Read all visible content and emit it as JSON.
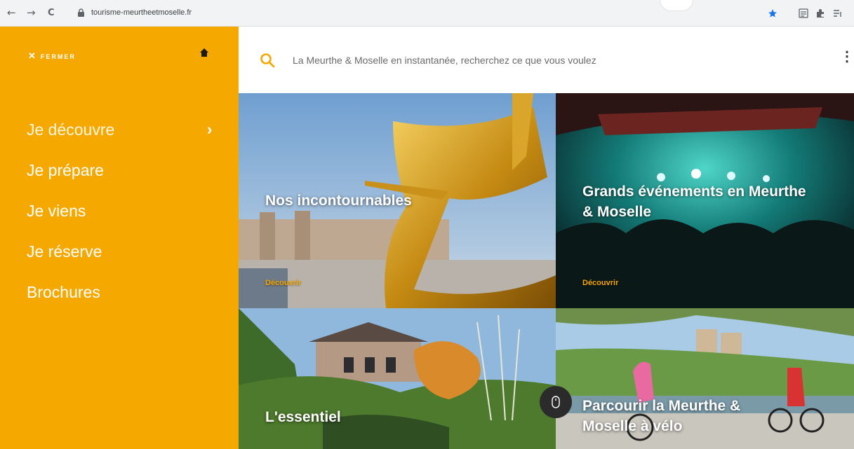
{
  "browser": {
    "url": "tourisme-meurtheetmoselle.fr",
    "back_glyph": "←",
    "forward_glyph": "→",
    "reload_glyph": "C"
  },
  "sidebar": {
    "close_label": "FERMER",
    "close_glyph": "✕",
    "menu": [
      {
        "label": "Je découvre"
      },
      {
        "label": "Je prépare"
      },
      {
        "label": "Je viens"
      },
      {
        "label": "Je réserve"
      },
      {
        "label": "Brochures"
      }
    ],
    "chevron": "›",
    "background": "#f5a800"
  },
  "search": {
    "placeholder": "La Meurthe & Moselle en instantanée, recherchez ce que vous voulez",
    "more": "⋮"
  },
  "tiles": [
    {
      "title": "Nos incontournables",
      "cta": "Découvrir"
    },
    {
      "title": "Grands événements en Meurthe & Moselle",
      "cta": "Découvrir"
    },
    {
      "title": "L'essentiel"
    },
    {
      "title": "Parcourir la Meurthe & Moselle à vélo"
    }
  ],
  "icons": [
    "home-icon",
    "search-icon",
    "mouse-scroll-icon",
    "star-icon",
    "lock-icon"
  ],
  "colors": {
    "accent": "#f5a800",
    "cta": "#f5a800"
  }
}
